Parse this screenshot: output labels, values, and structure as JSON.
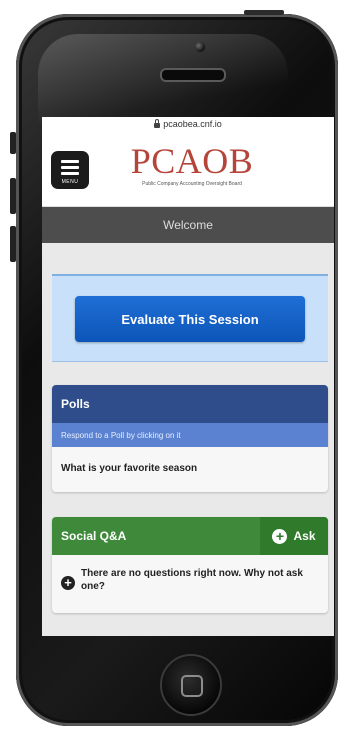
{
  "browser": {
    "url": "pcaobea.cnf.io"
  },
  "header": {
    "menu_label": "MENU",
    "logo_text": "PCAOB",
    "logo_subtitle": "Public Company Accounting Oversight Board"
  },
  "welcome_bar": {
    "title": "Welcome"
  },
  "evaluate": {
    "button_label": "Evaluate This Session"
  },
  "polls": {
    "title": "Polls",
    "subtitle": "Respond to a Poll by clicking on it",
    "items": [
      {
        "label": "What is your favorite season"
      }
    ]
  },
  "social_qa": {
    "title": "Social Q&A",
    "ask_label": "Ask",
    "empty_message": "There are no questions right now. Why not ask one?"
  },
  "colors": {
    "brand_red": "#b5453b",
    "evaluate_blue": "#0d55b8",
    "polls_header": "#2f4d8a",
    "polls_subheader": "#5b82d0",
    "qa_green": "#3e8a3a"
  },
  "icons": {
    "lock": "lock-icon",
    "menu": "hamburger-icon",
    "ask": "plus-circle-icon",
    "empty": "plus-circle-icon"
  }
}
